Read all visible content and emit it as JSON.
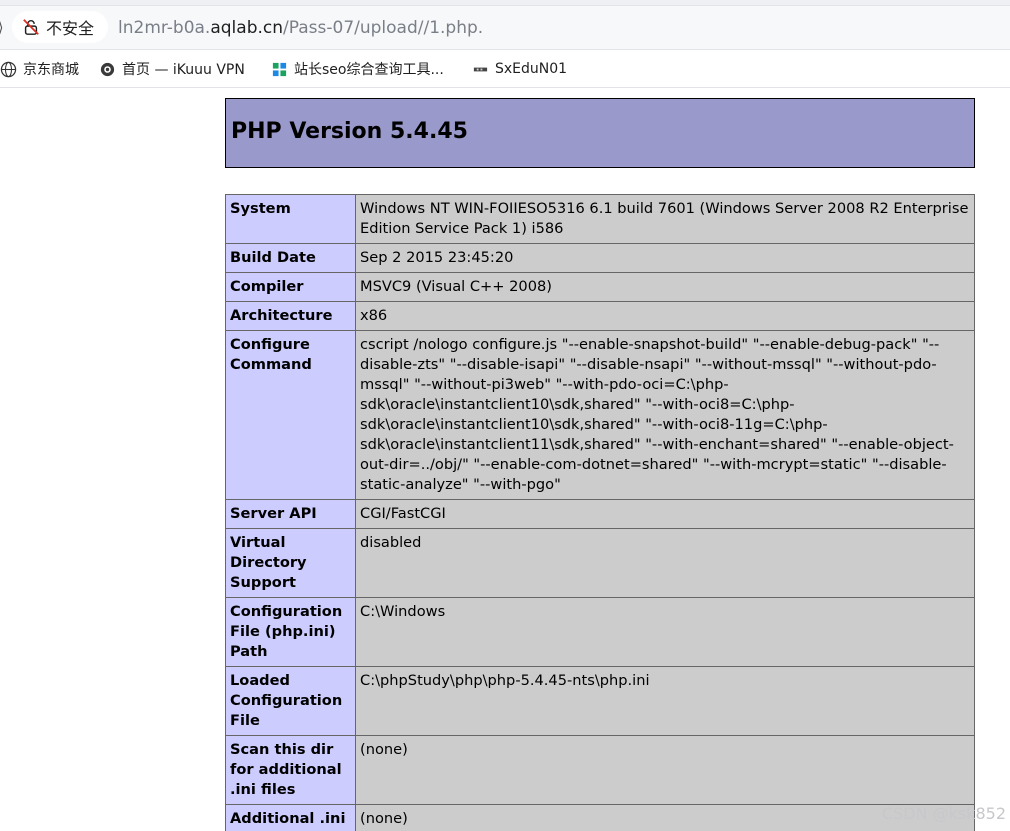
{
  "browser": {
    "security_label": "不安全",
    "url": {
      "prefix": "ln2mr-b0a.",
      "host": "aqlab.cn",
      "path": "/Pass-07/upload//1.php."
    },
    "bookmarks": [
      {
        "label": "京东商城",
        "icon": "globe-icon"
      },
      {
        "label": "首页 — iKuuu VPN",
        "icon": "ikuuu-icon"
      },
      {
        "label": "站长seo综合查询工具...",
        "icon": "seo-icon"
      },
      {
        "label": "SxEduN01",
        "icon": "site-icon"
      }
    ]
  },
  "phpinfo": {
    "title": "PHP Version 5.4.45",
    "rows": [
      {
        "key": "System",
        "value": "Windows NT WIN-FOIIESO5316 6.1 build 7601 (Windows Server 2008 R2 Enterprise Edition Service Pack 1) i586"
      },
      {
        "key": "Build Date",
        "value": "Sep 2 2015 23:45:20"
      },
      {
        "key": "Compiler",
        "value": "MSVC9 (Visual C++ 2008)"
      },
      {
        "key": "Architecture",
        "value": "x86"
      },
      {
        "key": "Configure Command",
        "value": "cscript /nologo configure.js \"--enable-snapshot-build\" \"--enable-debug-pack\" \"--disable-zts\" \"--disable-isapi\" \"--disable-nsapi\" \"--without-mssql\" \"--without-pdo-mssql\" \"--without-pi3web\" \"--with-pdo-oci=C:\\php-sdk\\oracle\\instantclient10\\sdk,shared\" \"--with-oci8=C:\\php-sdk\\oracle\\instantclient10\\sdk,shared\" \"--with-oci8-11g=C:\\php-sdk\\oracle\\instantclient11\\sdk,shared\" \"--with-enchant=shared\" \"--enable-object-out-dir=../obj/\" \"--enable-com-dotnet=shared\" \"--with-mcrypt=static\" \"--disable-static-analyze\" \"--with-pgo\""
      },
      {
        "key": "Server API",
        "value": "CGI/FastCGI"
      },
      {
        "key": "Virtual Directory Support",
        "value": "disabled"
      },
      {
        "key": "Configuration File (php.ini) Path",
        "value": "C:\\Windows"
      },
      {
        "key": "Loaded Configuration File",
        "value": "C:\\phpStudy\\php\\php-5.4.45-nts\\php.ini"
      },
      {
        "key": "Scan this dir for additional .ini files",
        "value": "(none)"
      },
      {
        "key": "Additional .ini files parsed",
        "value": "(none)"
      }
    ]
  },
  "watermark": "CSDN @ksk852",
  "colors": {
    "header_bg": "#9999cc",
    "key_cell_bg": "#ccccff",
    "value_cell_bg": "#cccccc",
    "security_warning": "#d93025"
  }
}
